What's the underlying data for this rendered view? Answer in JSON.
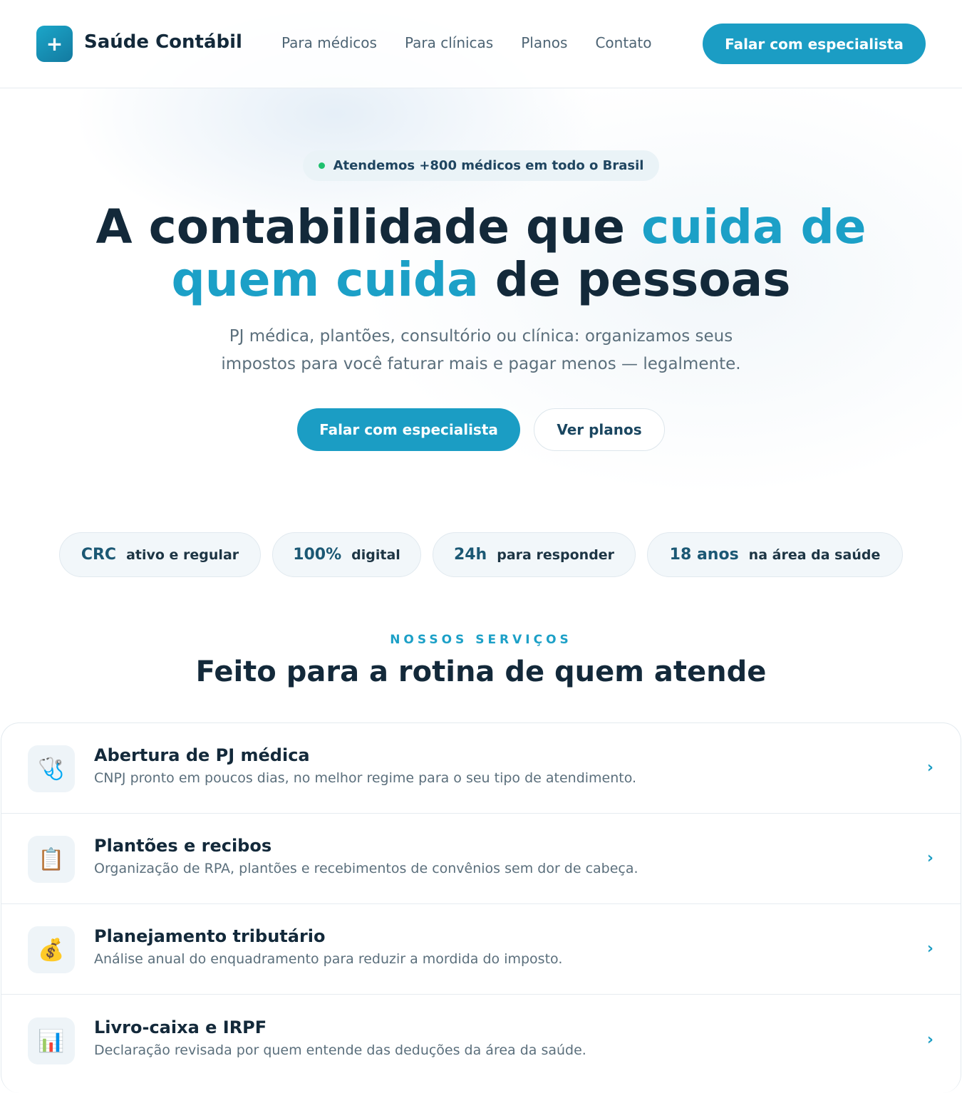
{
  "brand": {
    "logo_symbol": "+",
    "name": "Saúde Contábil"
  },
  "nav": {
    "items": [
      {
        "label": "Para médicos"
      },
      {
        "label": "Para clínicas"
      },
      {
        "label": "Planos"
      },
      {
        "label": "Contato"
      }
    ],
    "cta_label": "Falar com especialista"
  },
  "hero": {
    "badge": "Atendemos +800 médicos em todo o Brasil",
    "title_part1": "A contabilidade que ",
    "title_accent1": "cuida de",
    "title_accent2": "quem cuida",
    "title_part2": " de pessoas",
    "subtitle_line1": "PJ médica, plantões, consultório ou clínica: organizamos seus",
    "subtitle_line2": "impostos para você faturar mais e pagar menos — legalmente.",
    "primary_cta": "Falar com especialista",
    "secondary_cta": "Ver planos"
  },
  "stats": [
    {
      "value": "CRC",
      "label": "ativo e regular"
    },
    {
      "value": "100%",
      "label": "digital"
    },
    {
      "value": "24h",
      "label": "para responder"
    },
    {
      "value": "18 anos",
      "label": "na área da saúde"
    }
  ],
  "services": {
    "eyebrow": "NOSSOS SERVIÇOS",
    "title": "Feito para a rotina de quem atende",
    "items": [
      {
        "icon": "stethoscope-icon",
        "glyph": "🩺",
        "title": "Abertura de PJ médica",
        "desc": "CNPJ pronto em poucos dias, no melhor regime para o seu tipo de atendimento.",
        "chevron": "›"
      },
      {
        "icon": "clipboard-icon",
        "glyph": "📋",
        "title": "Plantões e recibos",
        "desc": "Organização de RPA, plantões e recebimentos de convênios sem dor de cabeça.",
        "chevron": "›"
      },
      {
        "icon": "money-bag-icon",
        "glyph": "💰",
        "title": "Planejamento tributário",
        "desc": "Análise anual do enquadramento para reduzir a mordida do imposto.",
        "chevron": "›"
      },
      {
        "icon": "bar-chart-icon",
        "glyph": "📊",
        "title": "Livro-caixa e IRPF",
        "desc": "Declaração revisada por quem entende das deduções da área da saúde.",
        "chevron": "›"
      }
    ]
  },
  "colors": {
    "accent": "#1b9dc4",
    "heading": "#13293a",
    "muted": "#5b6f7c",
    "status_dot": "#1fc06e"
  }
}
